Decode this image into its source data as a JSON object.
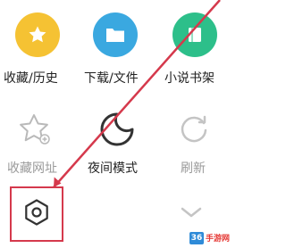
{
  "menu": {
    "row1": [
      {
        "label": "收藏/历史",
        "icon": "star-icon",
        "color": "#F5C233"
      },
      {
        "label": "下载/文件",
        "icon": "folder-icon",
        "color": "#3AA8E0"
      },
      {
        "label": "小说书架",
        "icon": "book-icon",
        "color": "#2DBF8A"
      }
    ],
    "row2": [
      {
        "label": "收藏网址",
        "icon": "star-add-icon"
      },
      {
        "label": "夜间模式",
        "icon": "moon-icon"
      },
      {
        "label": "刷新",
        "icon": "refresh-icon"
      }
    ],
    "row3": [
      {
        "icon": "settings-icon"
      },
      {
        "icon": "chevron-down-icon"
      }
    ]
  },
  "annotation": {
    "color": "#D5394C"
  },
  "watermark": {
    "badge": "36",
    "text": "手游网",
    "colors": {
      "badge": "#2F8BD8",
      "text": "#E53935"
    }
  }
}
